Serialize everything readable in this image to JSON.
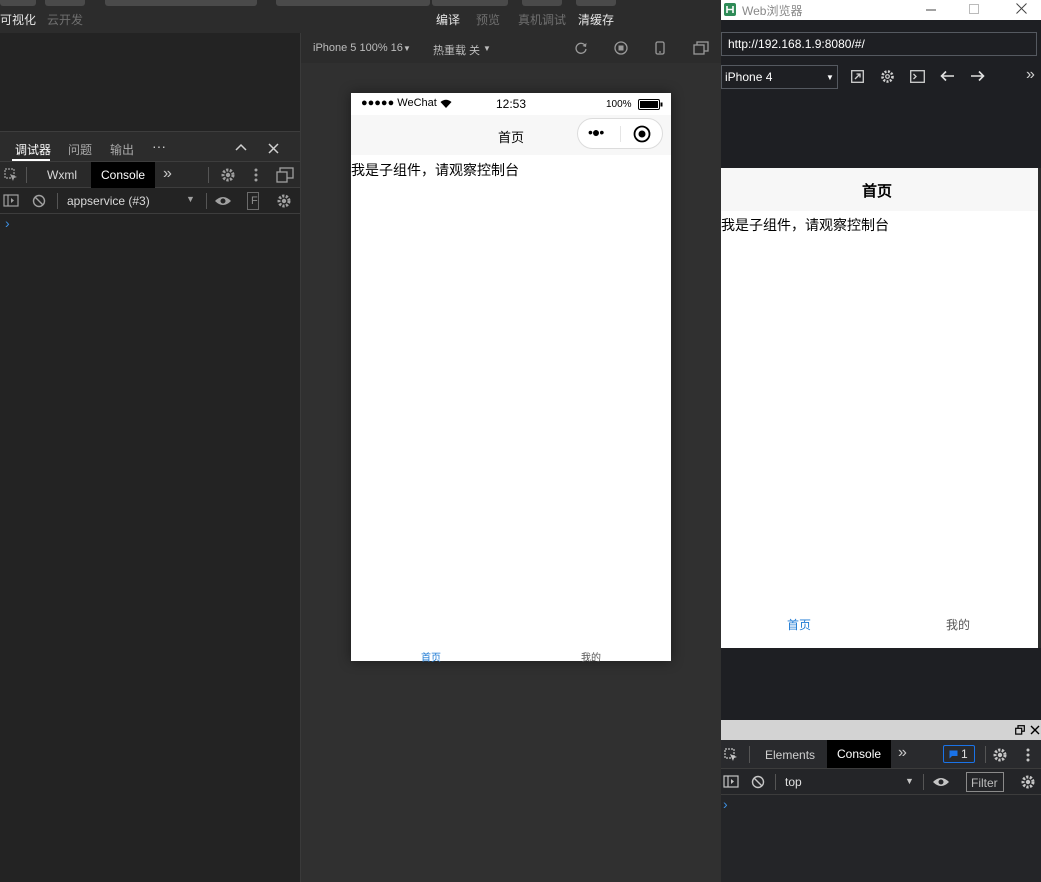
{
  "toolbar": {
    "visual": "可视化",
    "cloud": "云开发",
    "compile": "编译",
    "preview": "预览",
    "real_debug": "真机调试",
    "clear_cache": "清缓存"
  },
  "simulator": {
    "device": "iPhone 5 100% 16",
    "hot_reload": "热重载 关"
  },
  "debugger": {
    "tabs": [
      "调试器",
      "问题",
      "输出"
    ],
    "more": "···",
    "sub_tabs": [
      "Wxml",
      "Console"
    ],
    "chevron": "»",
    "context": "appservice (#3)",
    "filter_placeholder": "F",
    "prompt": "›"
  },
  "phone": {
    "carrier": "●●●●● WeChat",
    "time": "12:53",
    "battery": "100%",
    "nav_title": "首页",
    "capsule_menu": "•●•",
    "content": "我是子组件，请观察控制台",
    "tabs": [
      "首页",
      "我的"
    ]
  },
  "browser": {
    "title": "Web浏览器",
    "url": "http://192.168.1.9:8080/#/",
    "device": "iPhone 4",
    "page_title": "首页",
    "content": "我是子组件，请观察控制台",
    "tabs": [
      "首页",
      "我的"
    ]
  },
  "devtools": {
    "tabs": [
      "Elements",
      "Console"
    ],
    "chevron": "»",
    "badge": "1",
    "context": "top",
    "filter_placeholder": "Filter",
    "prompt": "›"
  },
  "colors": {
    "accent_blue": "#1f7bd4",
    "dark_bg": "#2c2c2c",
    "browser_dark": "#1e1f23"
  }
}
